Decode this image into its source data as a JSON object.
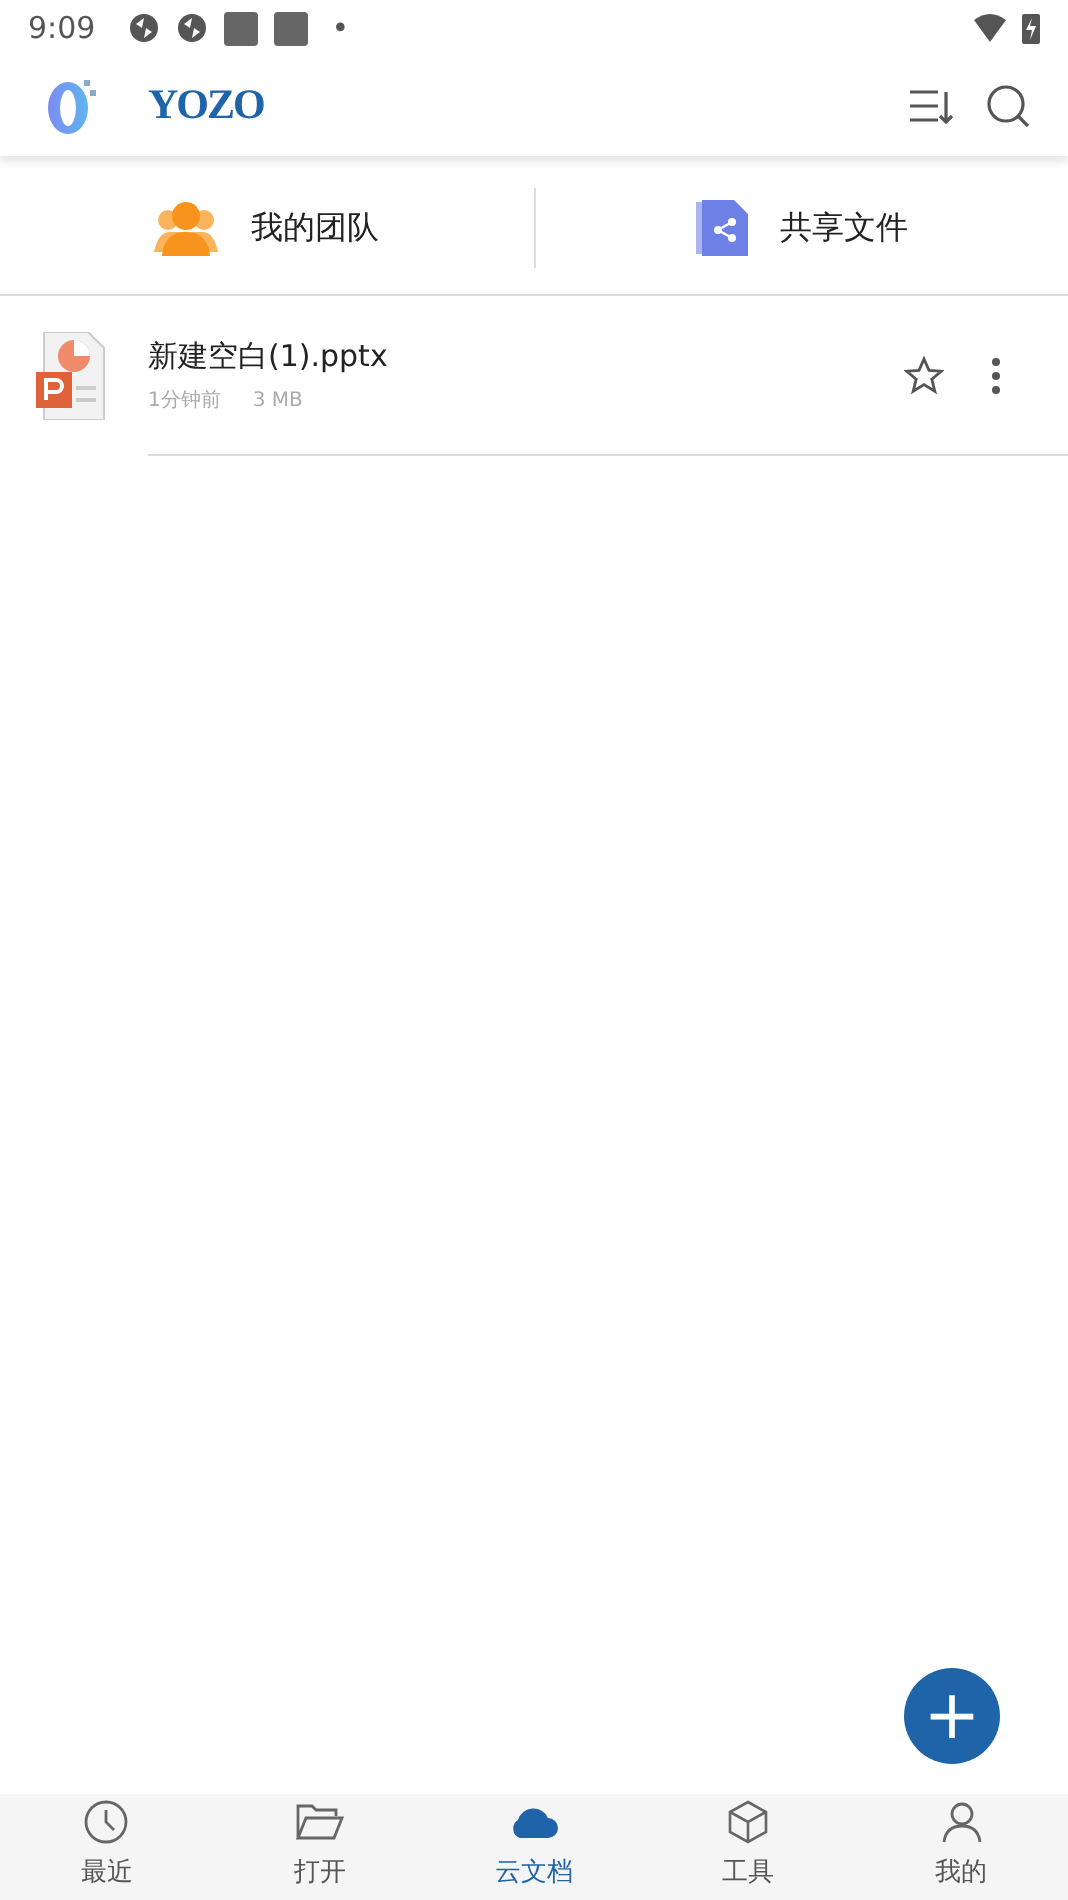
{
  "status_bar": {
    "time": "9:09",
    "notification_dot": "•"
  },
  "app_bar": {
    "logo_text": "YOZO"
  },
  "shortcuts": [
    {
      "kind": "team",
      "label": "我的团队"
    },
    {
      "kind": "share",
      "label": "共享文件"
    }
  ],
  "files": [
    {
      "name": "新建空白(1).pptx",
      "time": "1分钟前",
      "size": "3 MB",
      "starred": false
    }
  ],
  "fab": {
    "label": "+"
  },
  "bottom_nav": [
    {
      "kind": "clock",
      "label": "最近",
      "selected": false
    },
    {
      "kind": "folder",
      "label": "打开",
      "selected": false
    },
    {
      "kind": "cloud",
      "label": "云文档",
      "selected": true
    },
    {
      "kind": "box",
      "label": "工具",
      "selected": false
    },
    {
      "kind": "person",
      "label": "我的",
      "selected": false
    }
  ]
}
